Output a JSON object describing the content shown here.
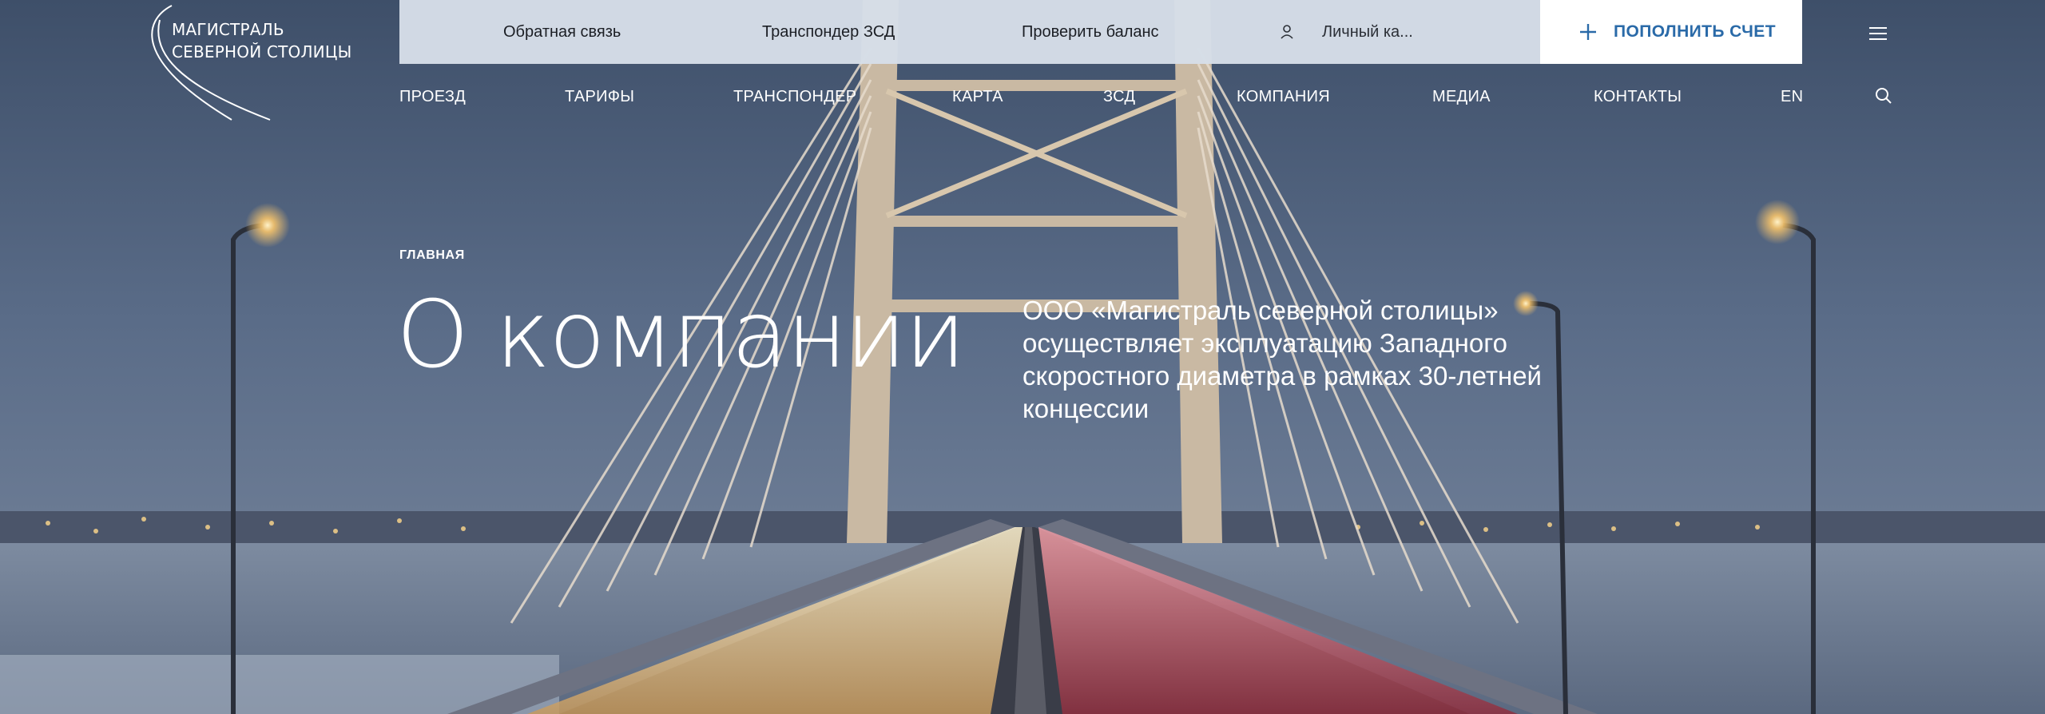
{
  "brand": {
    "line1": "МАГИСТРАЛЬ",
    "line2": "СЕВЕРНОЙ СТОЛИЦЫ"
  },
  "topbar": {
    "feedback": "Обратная связь",
    "transponder": "Транспондер ЗСД",
    "balance": "Проверить баланс",
    "account": "Личный ка...",
    "topup": "ПОПОЛНИТЬ СЧЕТ",
    "icons": {
      "account": "user-icon",
      "topup": "plus-icon",
      "menu": "hamburger-menu-icon"
    }
  },
  "nav": {
    "items": [
      "ПРОЕЗД",
      "ТАРИФЫ",
      "ТРАНСПОНДЕР",
      "КАРТА",
      "ЗСД",
      "КОМПАНИЯ",
      "МЕДИА",
      "КОНТАКТЫ",
      "EN"
    ],
    "icons": {
      "search": "search-icon"
    }
  },
  "hero": {
    "breadcrumb": "ГЛАВНАЯ",
    "title": "О компании",
    "lead": "ООО «Магистраль северной столицы» осуществляет эксплуатацию Западного скоростного диаметра в рамках 30-летней концессии"
  },
  "colors": {
    "topbar_bg": "#d6dee8",
    "accent": "#2a6aa8",
    "sky": "#3c4f6b"
  }
}
